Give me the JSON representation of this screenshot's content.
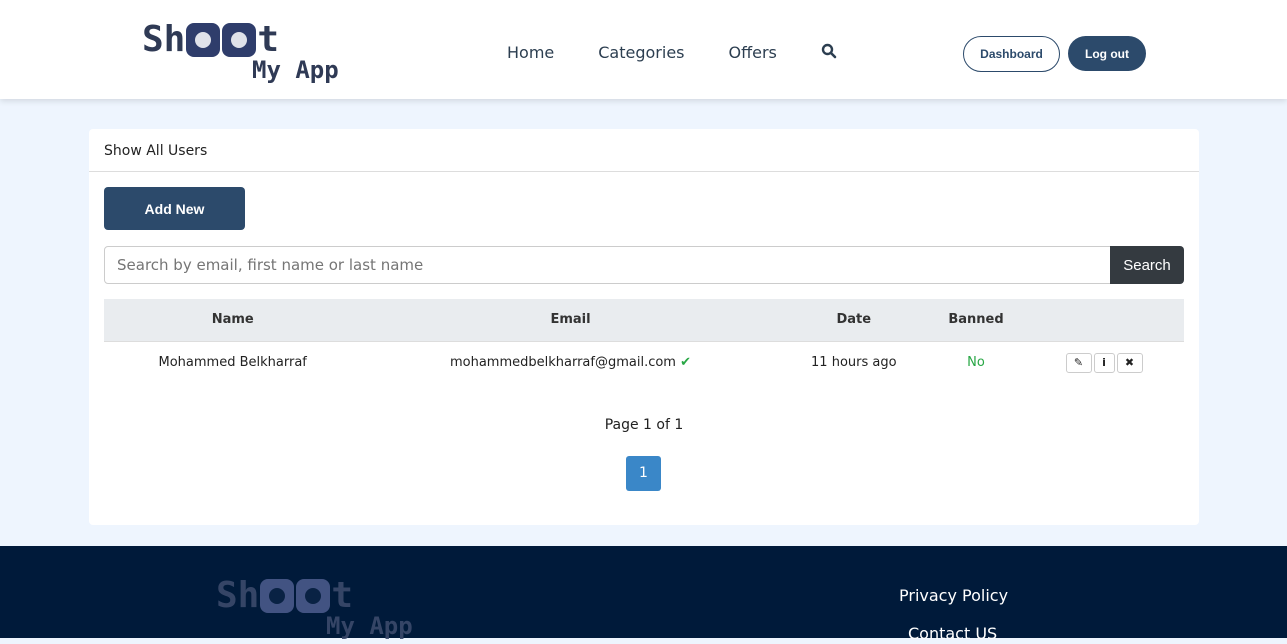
{
  "brand": {
    "logo_text_1": "Shoot",
    "logo_text_2": "My App"
  },
  "nav": {
    "items": [
      "Home",
      "Categories",
      "Offers"
    ],
    "search_icon": "search-icon"
  },
  "header_buttons": {
    "dashboard": "Dashboard",
    "logout": "Log out"
  },
  "card": {
    "title": "Show All Users",
    "add_label": "Add New",
    "search_placeholder": "Search by email, first name or last name",
    "search_button": "Search"
  },
  "table": {
    "headers": [
      "Name",
      "Email",
      "Date",
      "Banned",
      ""
    ],
    "rows": [
      {
        "name": "Mohammed Belkharraf",
        "email": "mohammedbelkharraf@gmail.com",
        "verified": "✔",
        "date": "11 hours ago",
        "banned": "No"
      }
    ]
  },
  "pagination": {
    "info": "Page 1 of 1",
    "pages": [
      "1"
    ]
  },
  "footer": {
    "links": [
      "Privacy Policy",
      "Contact US"
    ]
  },
  "colors": {
    "primary": "#2c4a6b",
    "footer": "#001a3a",
    "success": "#28a745",
    "page_active": "#3a87c8"
  }
}
